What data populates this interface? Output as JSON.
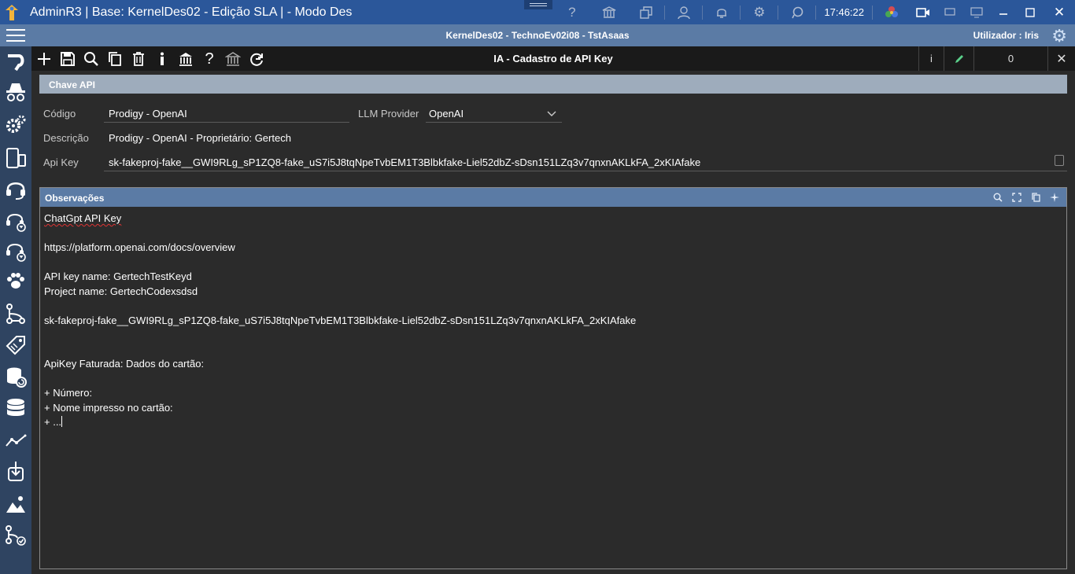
{
  "window": {
    "title": "AdminR3 | Base: KernelDes02 - Edição SLA | - Modo Des",
    "clock": "17:46:22"
  },
  "infobar": {
    "context": "KernelDes02 - TechnoEv02i08 - TstAsaas",
    "user_label": "Utilizador : Iris"
  },
  "toolbar": {
    "title": "IA - Cadastro de API Key",
    "info_label": "i",
    "counter": "0"
  },
  "form": {
    "section_title": "Chave API",
    "codigo_label": "Código",
    "codigo_value": "Prodigy - OpenAI",
    "llm_provider_label": "LLM Provider",
    "llm_provider_value": "OpenAI",
    "descricao_label": "Descrição",
    "descricao_value": "Prodigy - OpenAI - Proprietário: Gertech",
    "apikey_label": "Api Key",
    "apikey_value": "sk-fakeproj-fake__GWI9RLg_sP1ZQ8-fake_uS7i5J8tqNpeTvbEM1T3Blbkfake-Liel52dbZ-sDsn151LZq3v7qnxnAKLkFA_2xKIAfake"
  },
  "observacoes": {
    "title": "Observações",
    "lines": [
      "ChatGpt API Key",
      "",
      "https://platform.openai.com/docs/overview",
      "",
      "API key name: GertechTestKeyd",
      "Project name: GertechCodexsdsd",
      "",
      "sk-fakeproj-fake__GWI9RLg_sP1ZQ8-fake_uS7i5J8tqNpeTvbEM1T3Blbkfake-Liel52dbZ-sDsn151LZq3v7qnxnAKLkFA_2xKIAfake",
      "",
      "",
      "ApiKey Faturada: Dados do cartão:",
      "",
      "+ Número:",
      "+ Nome impresso no cartão:",
      "+ ..."
    ]
  },
  "colors": {
    "titlebar": "#2b579a",
    "infobar": "#5b7ba5",
    "sidebar": "#2f4461",
    "toolbar": "#1a1a1a",
    "background": "#2b2b2b",
    "section_bar": "#9eacbc"
  },
  "icons": {
    "titlebar": [
      "help-icon",
      "bank-icon",
      "windows-icon",
      "user-icon",
      "bell-icon",
      "gear-icon",
      "chat-icon",
      "palette-icon",
      "camera-icon",
      "minimize-icon",
      "restore-icon",
      "maximize-icon",
      "close-icon"
    ],
    "sidebar": [
      "magnet-icon",
      "detective-icon",
      "gears-icon",
      "devices-icon",
      "headset-icon",
      "headset-filter-icon",
      "headset-filter-2-icon",
      "paw-icon",
      "flow-icon",
      "tag-icon",
      "database-refresh-icon",
      "database-icon",
      "line-chart-icon",
      "download-icon",
      "image-icon",
      "flow-check-icon"
    ],
    "toolbar": [
      "add-icon",
      "save-icon",
      "search-icon",
      "copy-icon",
      "delete-icon",
      "info-icon",
      "bank-icon",
      "help-icon",
      "bank-alt-icon",
      "refresh-icon"
    ]
  }
}
